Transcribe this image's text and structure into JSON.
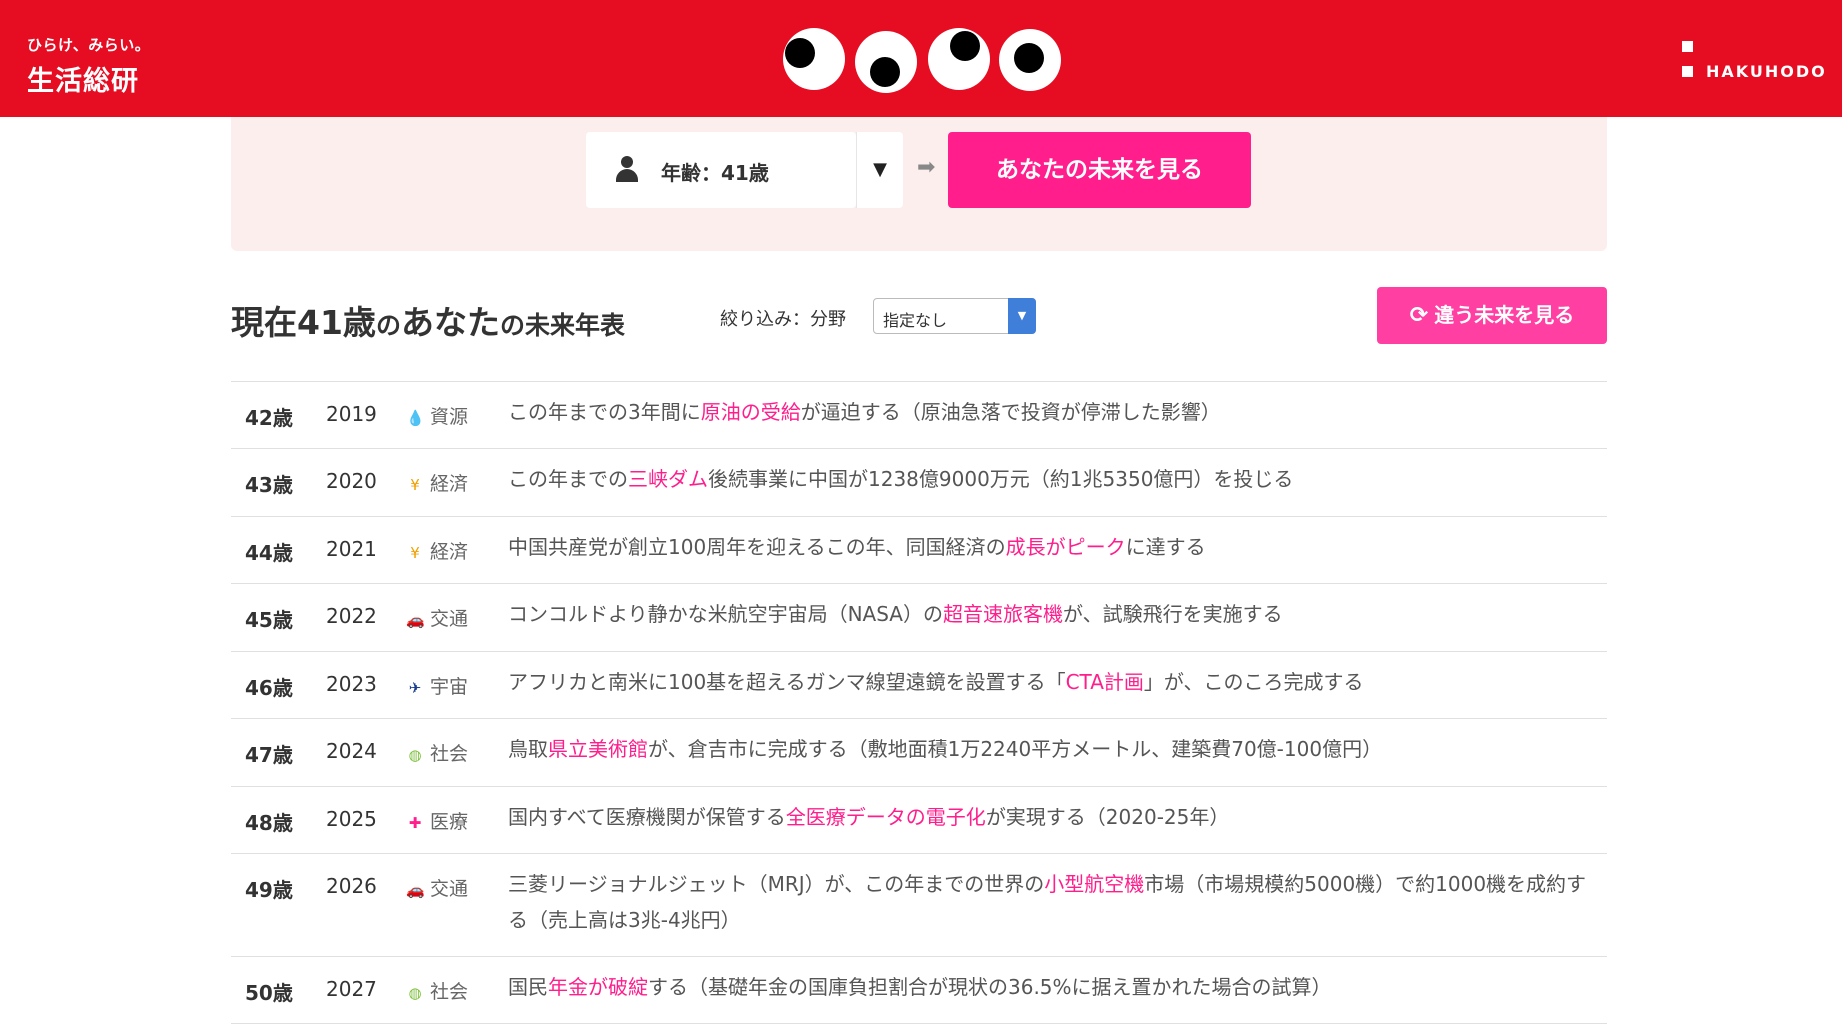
{
  "header": {
    "tagline": "ひらけ、みらい。",
    "org_name": "生活総研",
    "company": "HAKUHODO",
    "brand_color": "#e60c22"
  },
  "selector": {
    "age_label": "年齢：41歳",
    "dropdown_icon": "triangle-down",
    "arrow_icon": "arrow-right",
    "future_button": "あなたの未来を見る",
    "accent_color": "#ff1e8c"
  },
  "title": {
    "prefix": "現在41歳",
    "particle1": "の",
    "anata": "あなた",
    "suffix": "の未来年表"
  },
  "filter": {
    "label": "絞り込み：分野",
    "selected": "指定なし"
  },
  "alt_button": "違う未来を見る",
  "rows": [
    {
      "age": "42歳",
      "year": "2019",
      "icon": "drop-icon",
      "category": "資源",
      "pre": "この年までの3年間に",
      "hl": "原油の受給",
      "post": "が逼迫する（原油急落で投資が停滞した影響）"
    },
    {
      "age": "43歳",
      "year": "2020",
      "icon": "yen-icon",
      "category": "経済",
      "pre": "この年までの",
      "hl": "三峡ダム",
      "post": "後続事業に中国が1238億9000万元（約1兆5350億円）を投じる"
    },
    {
      "age": "44歳",
      "year": "2021",
      "icon": "yen-icon",
      "category": "経済",
      "pre": "中国共産党が創立100周年を迎えるこの年、同国経済の",
      "hl": "成長がピーク",
      "post": "に達する"
    },
    {
      "age": "45歳",
      "year": "2022",
      "icon": "car-icon",
      "category": "交通",
      "pre": "コンコルドより静かな米航空宇宙局（NASA）の",
      "hl": "超音速旅客機",
      "post": "が、試験飛行を実施する"
    },
    {
      "age": "46歳",
      "year": "2023",
      "icon": "rocket-icon",
      "category": "宇宙",
      "pre": "アフリカと南米に100基を超えるガンマ線望遠鏡を設置する「",
      "hl": "CTA計画",
      "post": "」が、このころ完成する"
    },
    {
      "age": "47歳",
      "year": "2024",
      "icon": "globe-icon",
      "category": "社会",
      "pre": "鳥取",
      "hl": "県立美術館",
      "post": "が、倉吉市に完成する（敷地面積1万2240平方メートル、建築費70億-100億円）"
    },
    {
      "age": "48歳",
      "year": "2025",
      "icon": "cross-icon",
      "category": "医療",
      "pre": "国内すべて医療機関が保管する",
      "hl": "全医療データの電子化",
      "post": "が実現する（2020-25年）"
    },
    {
      "age": "49歳",
      "year": "2026",
      "icon": "car-icon",
      "category": "交通",
      "pre": "三菱リージョナルジェット（MRJ）が、この年までの世界の",
      "hl": "小型航空機",
      "post": "市場（市場規模約5000機）で約1000機を成約する（売上高は3兆-4兆円）"
    },
    {
      "age": "50歳",
      "year": "2027",
      "icon": "globe-icon",
      "category": "社会",
      "pre": "国民",
      "hl": "年金が破綻",
      "post": "する（基礎年金の国庫負担割合が現状の36.5%に据え置かれた場合の試算）"
    }
  ]
}
